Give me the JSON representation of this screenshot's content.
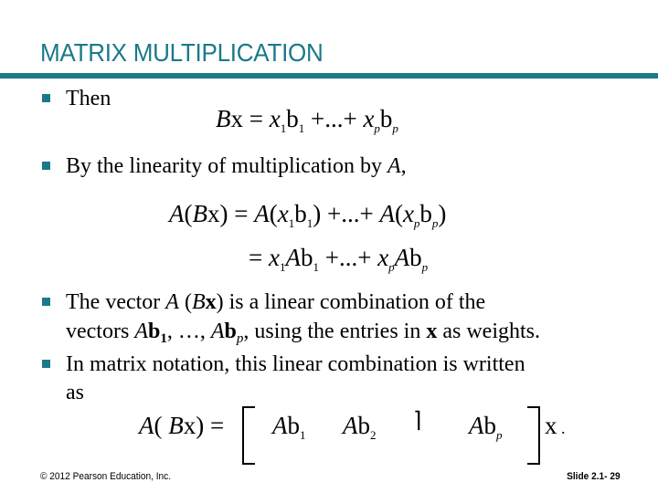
{
  "slide": {
    "title": "MATRIX MULTIPLICATION",
    "bullets": [
      {
        "text": "Then"
      },
      {
        "text_parts": [
          "By the linearity of multiplication by ",
          "A",
          ","
        ]
      },
      {
        "text_parts": [
          "The vector ",
          "A",
          " (",
          "B",
          "x",
          ") is a linear combination of the",
          "vectors ",
          "A",
          "b",
          "1",
          ", …, ",
          "A",
          "b",
          "p",
          ", using the entries in ",
          "x",
          " as weights."
        ]
      },
      {
        "text_parts": [
          "In matrix notation, this linear combination is written",
          "as"
        ]
      }
    ],
    "equations": {
      "eq1": {
        "lhs_B": "B",
        "lhs_x": "x",
        "eq": "=",
        "x": "x",
        "sub1": "1",
        "b": "b",
        "plus": "+",
        "dots": "...",
        "subp": "p"
      },
      "eq2": {
        "A": "A",
        "B": "B",
        "x": "x",
        "eq": "=",
        "b": "b",
        "sub1": "1",
        "subp": "p",
        "plus": "+",
        "dots": "..."
      },
      "eq4": {
        "A": "A",
        "B": "B",
        "x": "x",
        "eq": "=",
        "b": "b",
        "sub1": "1",
        "sub2": "2",
        "subp": "p",
        "missing_glyph": "⌉",
        "trail": "x",
        "period": "."
      }
    },
    "footer": {
      "copyright": "© 2012 Pearson Education, Inc.",
      "slide_number": "Slide 2.1- 29"
    },
    "colors": {
      "accent": "#1a7a8a"
    }
  }
}
